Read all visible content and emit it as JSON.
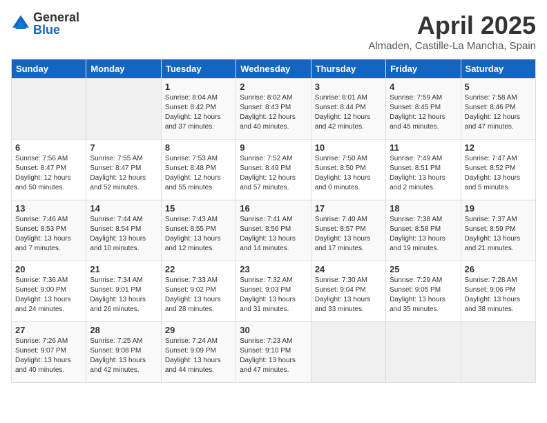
{
  "logo": {
    "general": "General",
    "blue": "Blue"
  },
  "title": "April 2025",
  "location": "Almaden, Castille-La Mancha, Spain",
  "weekdays": [
    "Sunday",
    "Monday",
    "Tuesday",
    "Wednesday",
    "Thursday",
    "Friday",
    "Saturday"
  ],
  "weeks": [
    [
      {
        "num": "",
        "sunrise": "",
        "sunset": "",
        "daylight": "",
        "empty": true
      },
      {
        "num": "",
        "sunrise": "",
        "sunset": "",
        "daylight": "",
        "empty": true
      },
      {
        "num": "1",
        "sunrise": "Sunrise: 8:04 AM",
        "sunset": "Sunset: 8:42 PM",
        "daylight": "Daylight: 12 hours and 37 minutes."
      },
      {
        "num": "2",
        "sunrise": "Sunrise: 8:02 AM",
        "sunset": "Sunset: 8:43 PM",
        "daylight": "Daylight: 12 hours and 40 minutes."
      },
      {
        "num": "3",
        "sunrise": "Sunrise: 8:01 AM",
        "sunset": "Sunset: 8:44 PM",
        "daylight": "Daylight: 12 hours and 42 minutes."
      },
      {
        "num": "4",
        "sunrise": "Sunrise: 7:59 AM",
        "sunset": "Sunset: 8:45 PM",
        "daylight": "Daylight: 12 hours and 45 minutes."
      },
      {
        "num": "5",
        "sunrise": "Sunrise: 7:58 AM",
        "sunset": "Sunset: 8:46 PM",
        "daylight": "Daylight: 12 hours and 47 minutes."
      }
    ],
    [
      {
        "num": "6",
        "sunrise": "Sunrise: 7:56 AM",
        "sunset": "Sunset: 8:47 PM",
        "daylight": "Daylight: 12 hours and 50 minutes."
      },
      {
        "num": "7",
        "sunrise": "Sunrise: 7:55 AM",
        "sunset": "Sunset: 8:47 PM",
        "daylight": "Daylight: 12 hours and 52 minutes."
      },
      {
        "num": "8",
        "sunrise": "Sunrise: 7:53 AM",
        "sunset": "Sunset: 8:48 PM",
        "daylight": "Daylight: 12 hours and 55 minutes."
      },
      {
        "num": "9",
        "sunrise": "Sunrise: 7:52 AM",
        "sunset": "Sunset: 8:49 PM",
        "daylight": "Daylight: 12 hours and 57 minutes."
      },
      {
        "num": "10",
        "sunrise": "Sunrise: 7:50 AM",
        "sunset": "Sunset: 8:50 PM",
        "daylight": "Daylight: 13 hours and 0 minutes."
      },
      {
        "num": "11",
        "sunrise": "Sunrise: 7:49 AM",
        "sunset": "Sunset: 8:51 PM",
        "daylight": "Daylight: 13 hours and 2 minutes."
      },
      {
        "num": "12",
        "sunrise": "Sunrise: 7:47 AM",
        "sunset": "Sunset: 8:52 PM",
        "daylight": "Daylight: 13 hours and 5 minutes."
      }
    ],
    [
      {
        "num": "13",
        "sunrise": "Sunrise: 7:46 AM",
        "sunset": "Sunset: 8:53 PM",
        "daylight": "Daylight: 13 hours and 7 minutes."
      },
      {
        "num": "14",
        "sunrise": "Sunrise: 7:44 AM",
        "sunset": "Sunset: 8:54 PM",
        "daylight": "Daylight: 13 hours and 10 minutes."
      },
      {
        "num": "15",
        "sunrise": "Sunrise: 7:43 AM",
        "sunset": "Sunset: 8:55 PM",
        "daylight": "Daylight: 13 hours and 12 minutes."
      },
      {
        "num": "16",
        "sunrise": "Sunrise: 7:41 AM",
        "sunset": "Sunset: 8:56 PM",
        "daylight": "Daylight: 13 hours and 14 minutes."
      },
      {
        "num": "17",
        "sunrise": "Sunrise: 7:40 AM",
        "sunset": "Sunset: 8:57 PM",
        "daylight": "Daylight: 13 hours and 17 minutes."
      },
      {
        "num": "18",
        "sunrise": "Sunrise: 7:38 AM",
        "sunset": "Sunset: 8:58 PM",
        "daylight": "Daylight: 13 hours and 19 minutes."
      },
      {
        "num": "19",
        "sunrise": "Sunrise: 7:37 AM",
        "sunset": "Sunset: 8:59 PM",
        "daylight": "Daylight: 13 hours and 21 minutes."
      }
    ],
    [
      {
        "num": "20",
        "sunrise": "Sunrise: 7:36 AM",
        "sunset": "Sunset: 9:00 PM",
        "daylight": "Daylight: 13 hours and 24 minutes."
      },
      {
        "num": "21",
        "sunrise": "Sunrise: 7:34 AM",
        "sunset": "Sunset: 9:01 PM",
        "daylight": "Daylight: 13 hours and 26 minutes."
      },
      {
        "num": "22",
        "sunrise": "Sunrise: 7:33 AM",
        "sunset": "Sunset: 9:02 PM",
        "daylight": "Daylight: 13 hours and 28 minutes."
      },
      {
        "num": "23",
        "sunrise": "Sunrise: 7:32 AM",
        "sunset": "Sunset: 9:03 PM",
        "daylight": "Daylight: 13 hours and 31 minutes."
      },
      {
        "num": "24",
        "sunrise": "Sunrise: 7:30 AM",
        "sunset": "Sunset: 9:04 PM",
        "daylight": "Daylight: 13 hours and 33 minutes."
      },
      {
        "num": "25",
        "sunrise": "Sunrise: 7:29 AM",
        "sunset": "Sunset: 9:05 PM",
        "daylight": "Daylight: 13 hours and 35 minutes."
      },
      {
        "num": "26",
        "sunrise": "Sunrise: 7:28 AM",
        "sunset": "Sunset: 9:06 PM",
        "daylight": "Daylight: 13 hours and 38 minutes."
      }
    ],
    [
      {
        "num": "27",
        "sunrise": "Sunrise: 7:26 AM",
        "sunset": "Sunset: 9:07 PM",
        "daylight": "Daylight: 13 hours and 40 minutes."
      },
      {
        "num": "28",
        "sunrise": "Sunrise: 7:25 AM",
        "sunset": "Sunset: 9:08 PM",
        "daylight": "Daylight: 13 hours and 42 minutes."
      },
      {
        "num": "29",
        "sunrise": "Sunrise: 7:24 AM",
        "sunset": "Sunset: 9:09 PM",
        "daylight": "Daylight: 13 hours and 44 minutes."
      },
      {
        "num": "30",
        "sunrise": "Sunrise: 7:23 AM",
        "sunset": "Sunset: 9:10 PM",
        "daylight": "Daylight: 13 hours and 47 minutes."
      },
      {
        "num": "",
        "sunrise": "",
        "sunset": "",
        "daylight": "",
        "empty": true
      },
      {
        "num": "",
        "sunrise": "",
        "sunset": "",
        "daylight": "",
        "empty": true
      },
      {
        "num": "",
        "sunrise": "",
        "sunset": "",
        "daylight": "",
        "empty": true
      }
    ]
  ]
}
